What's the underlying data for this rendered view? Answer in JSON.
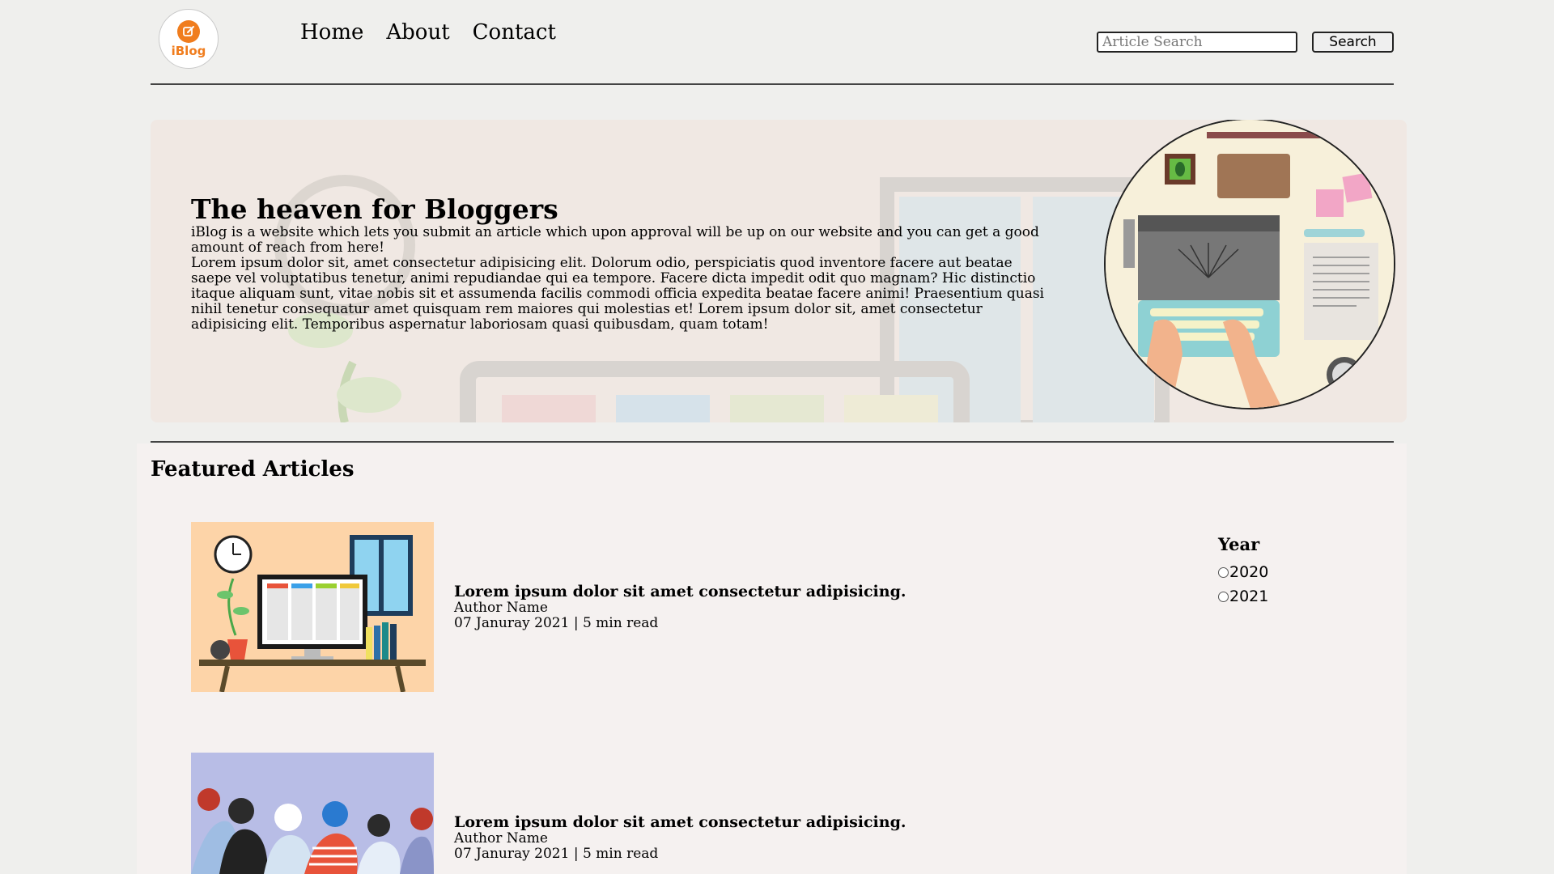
{
  "header": {
    "logo_text": "iBlog",
    "nav": [
      "Home",
      "About",
      "Contact"
    ],
    "search": {
      "placeholder": "Article Search",
      "button_label": "Search"
    }
  },
  "hero": {
    "title": "The heaven for Bloggers",
    "intro": "iBlog is a website which lets you submit an article which upon approval will be up on our website and you can get a good amount of reach from here!",
    "body": "Lorem ipsum dolor sit, amet consectetur adipisicing elit. Dolorum odio, perspiciatis quod inventore facere aut beatae saepe vel voluptatibus tenetur, animi repudiandae qui ea tempore. Facere dicta impedit odit quo magnam? Hic distinctio itaque aliquam sunt, vitae nobis sit et assumenda facilis commodi officia expedita beatae facere animi! Praesentium quasi nihil tenetur consequatur amet quisquam rem maiores qui molestias et! Lorem ipsum dolor sit, amet consectetur adipisicing elit. Temporibus aspernatur laboriosam quasi quibusdam, quam totam!"
  },
  "featured": {
    "title": "Featured Articles",
    "articles": [
      {
        "title": "Lorem ipsum dolor sit amet consectetur adipisicing.",
        "author": "Author Name",
        "meta": "07 Januray 2021 | 5 min read"
      },
      {
        "title": "Lorem ipsum dolor sit amet consectetur adipisicing.",
        "author": "Author Name",
        "meta": "07 Januray 2021 | 5 min read"
      }
    ]
  },
  "filter": {
    "title": "Year",
    "options": [
      "2020",
      "2021"
    ]
  },
  "colors": {
    "brand": "#f07d1e",
    "background": "#efefed",
    "hero": "#f0e8e3"
  }
}
